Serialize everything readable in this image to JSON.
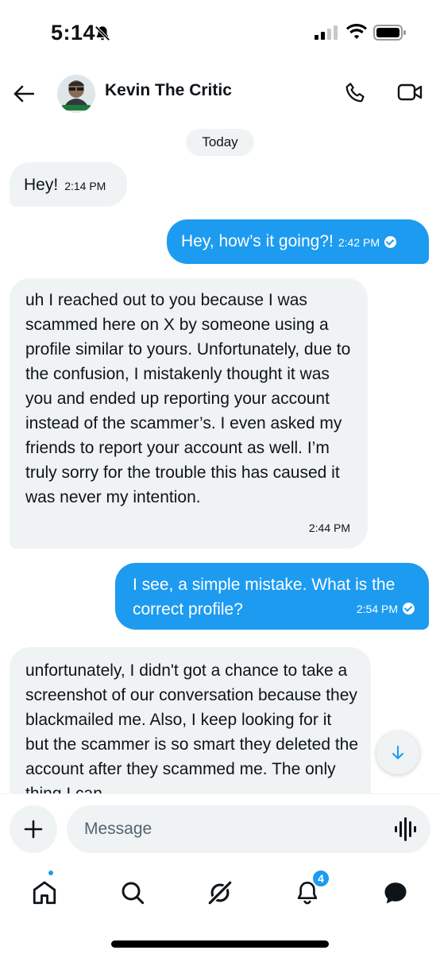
{
  "status_bar": {
    "time": "5:14",
    "icons": [
      "bell-slash-icon",
      "cellular-signal-icon",
      "wifi-icon",
      "battery-icon"
    ]
  },
  "header": {
    "contact_name": "Kevin The Critic",
    "back_icon": "arrow-left-icon",
    "call_icon": "phone-icon",
    "video_icon": "video-camera-icon"
  },
  "conversation": {
    "date_label": "Today",
    "messages": [
      {
        "direction": "incoming",
        "text": "Hey!",
        "time": "2:14 PM"
      },
      {
        "direction": "outgoing",
        "text": "Hey, how’s it going?!",
        "time": "2:42 PM",
        "read": true
      },
      {
        "direction": "incoming",
        "text": "uh I reached out to you because I was scammed here on X by someone using a profile similar to yours. Unfortunately, due to the confusion, I mistakenly thought it was you and ended up reporting your account instead of the scammer’s. I even asked my friends to report your account as well. I’m truly sorry for the trouble this has caused it was never my intention.",
        "time": "2:44 PM"
      },
      {
        "direction": "outgoing",
        "text": "I see, a simple mistake. What is the correct profile?",
        "time": "2:54 PM",
        "read": true
      },
      {
        "direction": "incoming",
        "text": "unfortunately, I didn't got a chance to take a screenshot of our conversation because they blackmailed me. Also, I keep looking for it but the scammer is so smart they deleted the account after they scammed me. The only thing I can",
        "time": ""
      }
    ]
  },
  "composer": {
    "placeholder": "Message",
    "value": "",
    "add_icon": "plus-icon",
    "voice_icon": "voice-waveform-icon"
  },
  "bottom_nav": {
    "items": [
      "home-icon",
      "search-icon",
      "grok-icon",
      "bell-icon",
      "messages-icon"
    ],
    "notification_count": "4"
  },
  "colors": {
    "accent": "#1d9bf0",
    "incoming_bubble": "#eff3f4",
    "text": "#0f1419",
    "muted": "#536471"
  }
}
